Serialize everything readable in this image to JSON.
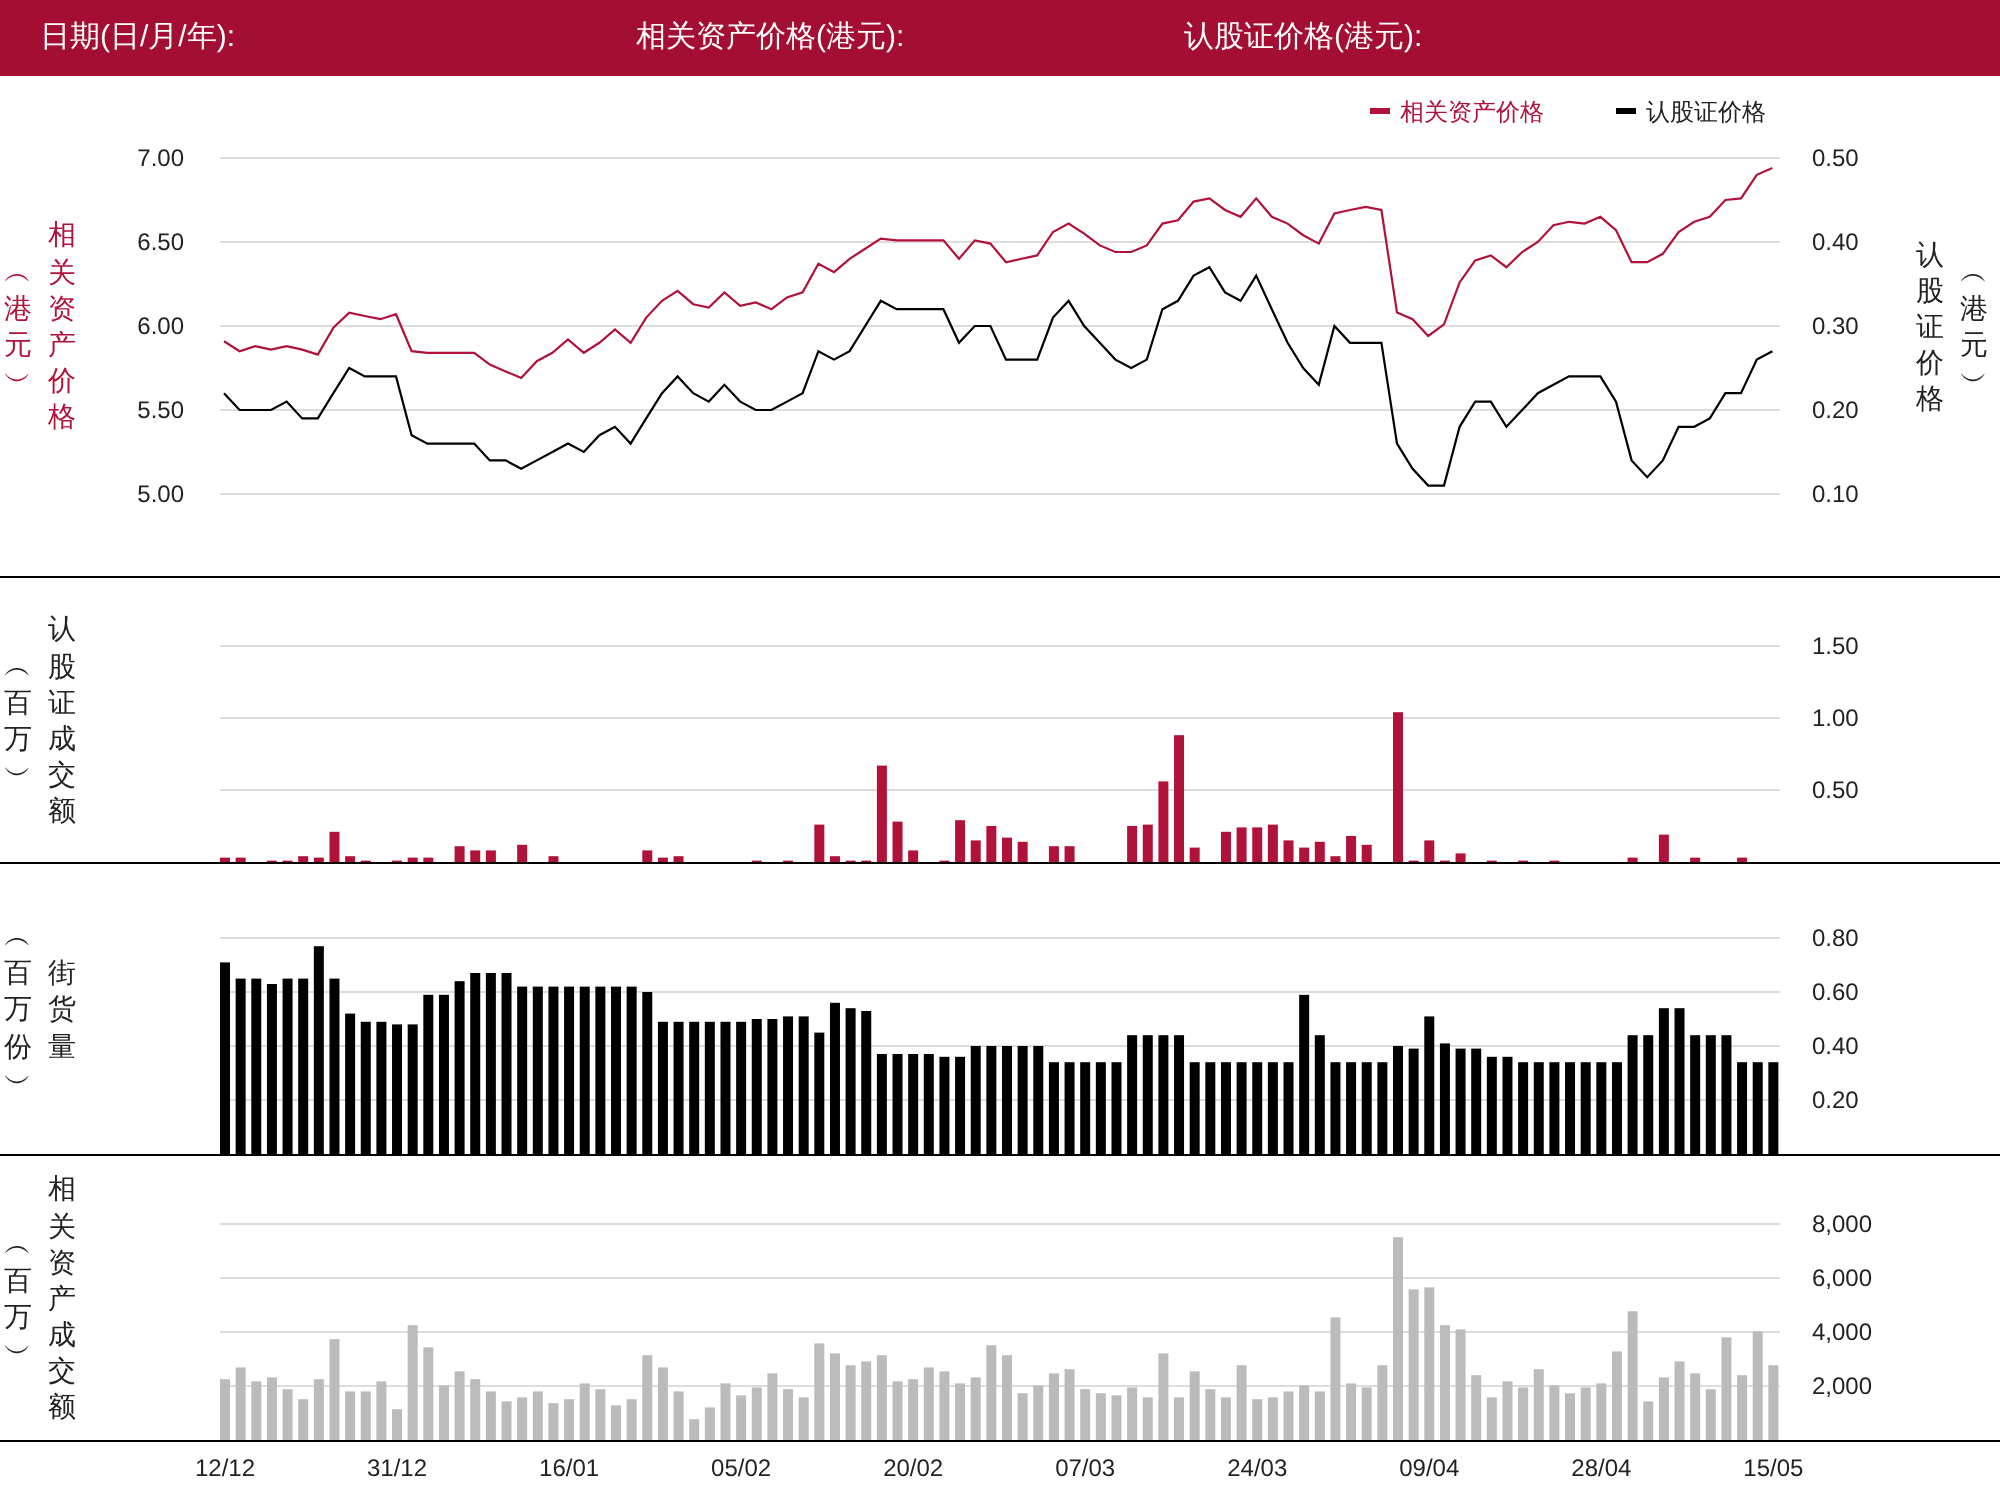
{
  "header": {
    "fields": [
      "日期(日/月/年):",
      "相关资产价格(港元):",
      "认股证价格(港元):"
    ]
  },
  "panels": [
    {
      "axis_unit": "︵港元︶",
      "axis2_unit": "︵港元︶",
      "chart_data": {
        "type": "line",
        "grid": true,
        "legend": true,
        "ylabel": "相关资产价格",
        "y2label": "认股证价格",
        "ylim": [
          5,
          7
        ],
        "y2lim": [
          0.1,
          0.5
        ],
        "yticks": [
          {
            "value": 7,
            "label": "7.00"
          },
          {
            "value": 6.5,
            "label": "6.50"
          },
          {
            "value": 6,
            "label": "6.00"
          },
          {
            "value": 5.5,
            "label": "5.50"
          },
          {
            "value": 5,
            "label": "5.00"
          }
        ],
        "y2ticks": [
          {
            "value": 0.5,
            "label": "0.50"
          },
          {
            "value": 0.4,
            "label": "0.40"
          },
          {
            "value": 0.3,
            "label": "0.30"
          },
          {
            "value": 0.2,
            "label": "0.20"
          },
          {
            "value": 0.1,
            "label": "0.10"
          }
        ],
        "series": [
          {
            "name": "相关资产价格",
            "color": "#b0123a",
            "values": [
              5.91,
              5.85,
              5.88,
              5.86,
              5.88,
              5.86,
              5.83,
              5.99,
              6.08,
              6.06,
              6.04,
              6.07,
              5.85,
              5.84,
              5.84,
              5.84,
              5.84,
              5.77,
              5.73,
              5.69,
              5.79,
              5.84,
              5.92,
              5.84,
              5.9,
              5.98,
              5.9,
              6.05,
              6.15,
              6.21,
              6.13,
              6.11,
              6.2,
              6.12,
              6.14,
              6.1,
              6.17,
              6.2,
              6.37,
              6.32,
              6.4,
              6.46,
              6.52,
              6.51,
              6.51,
              6.51,
              6.51,
              6.4,
              6.51,
              6.49,
              6.38,
              6.4,
              6.42,
              6.56,
              6.61,
              6.55,
              6.48,
              6.44,
              6.44,
              6.48,
              6.61,
              6.63,
              6.74,
              6.76,
              6.69,
              6.65,
              6.76,
              6.65,
              6.61,
              6.54,
              6.49,
              6.67,
              6.69,
              6.71,
              6.69,
              6.08,
              6.04,
              5.94,
              6.01,
              6.26,
              6.39,
              6.42,
              6.35,
              6.44,
              6.5,
              6.6,
              6.62,
              6.61,
              6.65,
              6.57,
              6.38,
              6.38,
              6.43,
              6.56,
              6.62,
              6.65,
              6.75,
              6.76,
              6.9,
              6.94
            ]
          },
          {
            "name": "认股证价格",
            "color": "#000000",
            "axis": "y2",
            "values": [
              0.22,
              0.2,
              0.2,
              0.2,
              0.21,
              0.19,
              0.19,
              0.22,
              0.25,
              0.24,
              0.24,
              0.24,
              0.17,
              0.16,
              0.16,
              0.16,
              0.16,
              0.14,
              0.14,
              0.13,
              0.14,
              0.15,
              0.16,
              0.15,
              0.17,
              0.18,
              0.16,
              0.19,
              0.22,
              0.24,
              0.22,
              0.21,
              0.23,
              0.21,
              0.2,
              0.2,
              0.21,
              0.22,
              0.27,
              0.26,
              0.27,
              0.3,
              0.33,
              0.32,
              0.32,
              0.32,
              0.32,
              0.28,
              0.3,
              0.3,
              0.26,
              0.26,
              0.26,
              0.31,
              0.33,
              0.3,
              0.28,
              0.26,
              0.25,
              0.26,
              0.32,
              0.33,
              0.36,
              0.37,
              0.34,
              0.33,
              0.36,
              0.32,
              0.28,
              0.25,
              0.23,
              0.3,
              0.28,
              0.28,
              0.28,
              0.16,
              0.13,
              0.11,
              0.11,
              0.18,
              0.21,
              0.21,
              0.18,
              0.2,
              0.22,
              0.23,
              0.24,
              0.24,
              0.24,
              0.21,
              0.14,
              0.12,
              0.14,
              0.18,
              0.18,
              0.19,
              0.22,
              0.22,
              0.26,
              0.27
            ]
          }
        ]
      }
    },
    {
      "axis_unit": "︵百万︶",
      "chart_data": {
        "type": "bar",
        "grid": true,
        "ylabel": "认股证成交额",
        "ylim": [
          0,
          1.5
        ],
        "yticks": [
          {
            "value": 0.5,
            "label": "0.50"
          },
          {
            "value": 1,
            "label": "1.00"
          },
          {
            "value": 1.5,
            "label": "1.50"
          }
        ],
        "series": [
          {
            "color": "#b0123a",
            "values": [
              0.03,
              0.03,
              0,
              0.01,
              0.01,
              0.04,
              0.03,
              0.21,
              0.04,
              0.01,
              0,
              0.01,
              0.03,
              0.03,
              0,
              0.11,
              0.08,
              0.08,
              0,
              0.12,
              0,
              0.04,
              0,
              0,
              0,
              0,
              0,
              0.08,
              0.03,
              0.04,
              0,
              0,
              0,
              0,
              0.01,
              0,
              0.01,
              0,
              0.26,
              0.04,
              0.01,
              0.01,
              0.67,
              0.28,
              0.08,
              0,
              0.01,
              0.29,
              0.15,
              0.25,
              0.17,
              0.14,
              0,
              0.11,
              0.11,
              0,
              0,
              0,
              0.25,
              0.26,
              0.56,
              0.88,
              0.1,
              0,
              0.21,
              0.24,
              0.24,
              0.26,
              0.15,
              0.1,
              0.14,
              0.04,
              0.18,
              0.12,
              0,
              1.04,
              0.01,
              0.15,
              0.01,
              0.06,
              0,
              0.01,
              0,
              0.01,
              0,
              0.01,
              0,
              0,
              0,
              0,
              0.03,
              0,
              0.19,
              0,
              0.03,
              0,
              0,
              0.03,
              0,
              0
            ]
          }
        ]
      }
    },
    {
      "axis_unit": "︵百万份︶",
      "chart_data": {
        "type": "bar",
        "grid": true,
        "ylabel": "街货量",
        "ylim": [
          0,
          0.8
        ],
        "yticks": [
          {
            "value": 0.2,
            "label": "0.20"
          },
          {
            "value": 0.4,
            "label": "0.40"
          },
          {
            "value": 0.6,
            "label": "0.60"
          },
          {
            "value": 0.8,
            "label": "0.80"
          }
        ],
        "series": [
          {
            "color": "#000000",
            "values": [
              0.71,
              0.65,
              0.65,
              0.63,
              0.65,
              0.65,
              0.77,
              0.65,
              0.52,
              0.49,
              0.49,
              0.48,
              0.48,
              0.59,
              0.59,
              0.64,
              0.67,
              0.67,
              0.67,
              0.62,
              0.62,
              0.62,
              0.62,
              0.62,
              0.62,
              0.62,
              0.62,
              0.6,
              0.49,
              0.49,
              0.49,
              0.49,
              0.49,
              0.49,
              0.5,
              0.5,
              0.51,
              0.51,
              0.45,
              0.56,
              0.54,
              0.53,
              0.37,
              0.37,
              0.37,
              0.37,
              0.36,
              0.36,
              0.4,
              0.4,
              0.4,
              0.4,
              0.4,
              0.34,
              0.34,
              0.34,
              0.34,
              0.34,
              0.44,
              0.44,
              0.44,
              0.44,
              0.34,
              0.34,
              0.34,
              0.34,
              0.34,
              0.34,
              0.34,
              0.59,
              0.44,
              0.34,
              0.34,
              0.34,
              0.34,
              0.4,
              0.39,
              0.51,
              0.41,
              0.39,
              0.39,
              0.36,
              0.36,
              0.34,
              0.34,
              0.34,
              0.34,
              0.34,
              0.34,
              0.34,
              0.44,
              0.44,
              0.54,
              0.54,
              0.44,
              0.44,
              0.44,
              0.34,
              0.34,
              0.34
            ]
          }
        ]
      }
    },
    {
      "axis_unit": "︵百万︶",
      "chart_data": {
        "type": "bar",
        "grid": true,
        "ylabel": "相关资产成交额",
        "ylim": [
          0,
          8000
        ],
        "yticks": [
          {
            "value": 2000,
            "label": "2,000"
          },
          {
            "value": 4000,
            "label": "4,000"
          },
          {
            "value": 6000,
            "label": "6,000"
          },
          {
            "value": 8000,
            "label": "8,000"
          }
        ],
        "categories": [
          "12/12",
          null,
          null,
          null,
          null,
          null,
          null,
          null,
          null,
          null,
          null,
          "31/12",
          null,
          null,
          null,
          null,
          null,
          null,
          null,
          null,
          null,
          null,
          "16/01",
          null,
          null,
          null,
          null,
          null,
          null,
          null,
          null,
          null,
          null,
          "05/02",
          null,
          null,
          null,
          null,
          null,
          null,
          null,
          null,
          null,
          null,
          "20/02",
          null,
          null,
          null,
          null,
          null,
          null,
          null,
          null,
          null,
          null,
          "07/03",
          null,
          null,
          null,
          null,
          null,
          null,
          null,
          null,
          null,
          null,
          "24/03",
          null,
          null,
          null,
          null,
          null,
          null,
          null,
          null,
          null,
          null,
          "09/04",
          null,
          null,
          null,
          null,
          null,
          null,
          null,
          null,
          null,
          null,
          "28/04",
          null,
          null,
          null,
          null,
          null,
          null,
          null,
          null,
          null,
          null,
          "15/05"
        ],
        "series": [
          {
            "color": "#bbbbbb",
            "values": [
              2250,
              2690,
              2170,
              2320,
              1880,
              1510,
              2250,
              3730,
              1800,
              1800,
              2170,
              1140,
              4250,
              3430,
              2020,
              2540,
              2250,
              1800,
              1430,
              1580,
              1800,
              1360,
              1510,
              2100,
              1880,
              1280,
              1510,
              3140,
              2690,
              1800,
              770,
              1210,
              2100,
              1650,
              1950,
              2470,
              1880,
              1580,
              3580,
              3210,
              2770,
              2910,
              3140,
              2170,
              2250,
              2690,
              2540,
              2100,
              2320,
              3510,
              3140,
              1730,
              2020,
              2470,
              2620,
              1880,
              1730,
              1650,
              1950,
              1580,
              3210,
              1580,
              2540,
              1880,
              1580,
              2770,
              1510,
              1580,
              1800,
              2020,
              1800,
              4540,
              2100,
              1950,
              2770,
              7510,
              5580,
              5650,
              4250,
              4100,
              2400,
              1580,
              2170,
              1950,
              2620,
              2020,
              1730,
              1950,
              2100,
              3280,
              4770,
              1430,
              2320,
              2910,
              2470,
              1880,
              3800,
              2400,
              4020,
              2770
            ]
          }
        ]
      }
    }
  ]
}
